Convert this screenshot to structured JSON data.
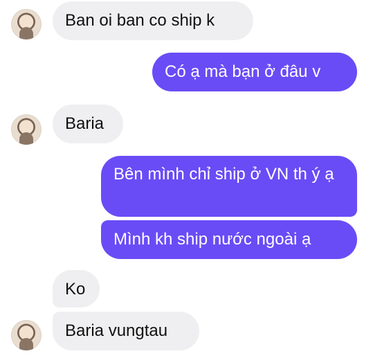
{
  "conversation": {
    "messages": [
      {
        "sender": "contact",
        "text": "Ban oi ban co ship k"
      },
      {
        "sender": "me",
        "text": "Có ạ mà bạn ở đâu v"
      },
      {
        "sender": "contact",
        "text": "Baria"
      },
      {
        "sender": "me",
        "text": "Bên mình chỉ ship ở VN th ý ạ"
      },
      {
        "sender": "me",
        "text": "Mình kh ship nước ngoài ạ"
      },
      {
        "sender": "contact",
        "text": "Ko"
      },
      {
        "sender": "contact",
        "text": "Baria vungtau"
      }
    ]
  },
  "colors": {
    "outgoing_bubble": "#6a4cf6",
    "incoming_bubble": "#efeff1",
    "background": "#ffffff"
  },
  "icons": {
    "avatar": "contact-avatar-photo"
  }
}
